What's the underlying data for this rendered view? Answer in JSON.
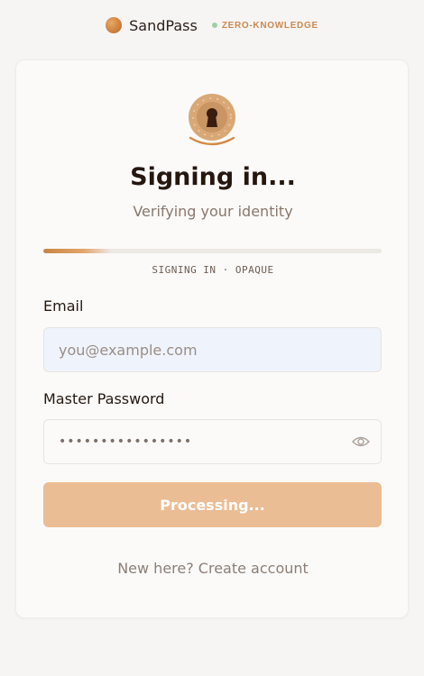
{
  "header": {
    "brand_name": "SandPass",
    "badge": "ZERO-KNOWLEDGE"
  },
  "auth": {
    "title": "Signing in...",
    "subtitle": "Verifying your identity",
    "progress": 0.2,
    "status": "SIGNING IN · OPAQUE"
  },
  "form": {
    "email_label": "Email",
    "email_placeholder": "you@example.com",
    "email_value": "",
    "password_label": "Master Password",
    "password_value": "••••••••••••••••",
    "submit_label": "Processing...",
    "create_account_link": "New here? Create account"
  },
  "icons": {
    "logo": "brand-orb-icon",
    "lock": "keyhole-lock-icon",
    "reveal": "eye-icon"
  },
  "colors": {
    "accent": "#c98444",
    "button_disabled": "#ebbd95",
    "badge_text": "#c98a52",
    "badge_dot": "#9ecfa9"
  }
}
